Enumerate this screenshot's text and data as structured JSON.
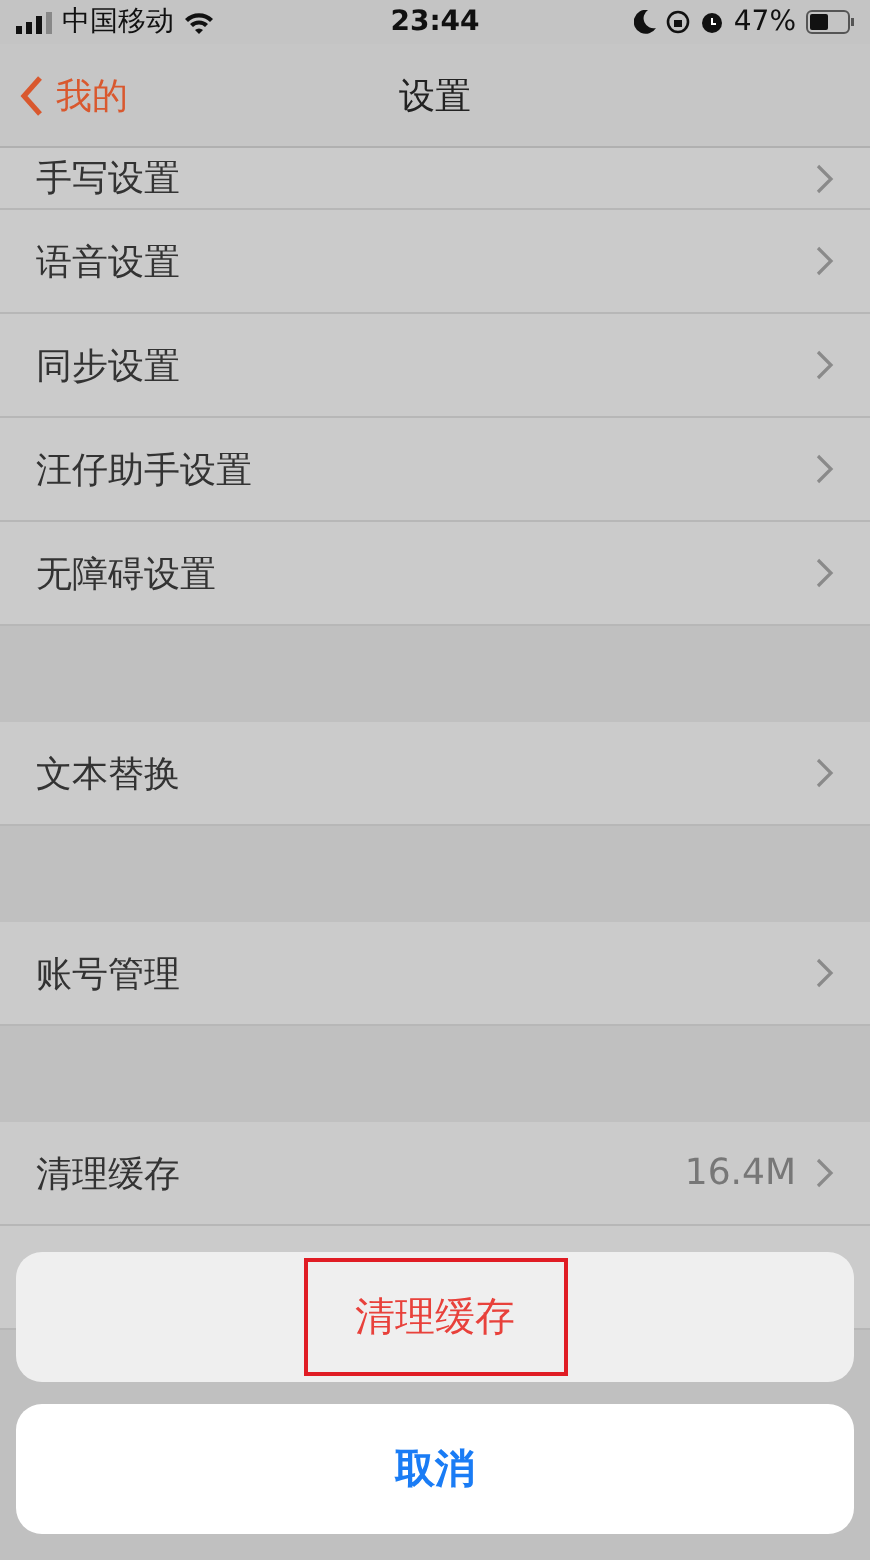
{
  "status_bar": {
    "carrier": "中国移动",
    "time": "23:44",
    "battery": "47%"
  },
  "nav": {
    "back": "我的",
    "title": "设置"
  },
  "groups": [
    {
      "rows": [
        {
          "label": "手写设置"
        },
        {
          "label": "语音设置"
        },
        {
          "label": "同步设置"
        },
        {
          "label": "汪仔助手设置"
        },
        {
          "label": "无障碍设置"
        }
      ]
    },
    {
      "rows": [
        {
          "label": "文本替换"
        }
      ]
    },
    {
      "rows": [
        {
          "label": "账号管理"
        }
      ]
    },
    {
      "rows": [
        {
          "label": "清理缓存",
          "value": "16.4M"
        }
      ]
    }
  ],
  "action_sheet": {
    "actions": [
      {
        "label": "清理缓存",
        "highlighted": true
      }
    ],
    "cancel": "取消"
  }
}
